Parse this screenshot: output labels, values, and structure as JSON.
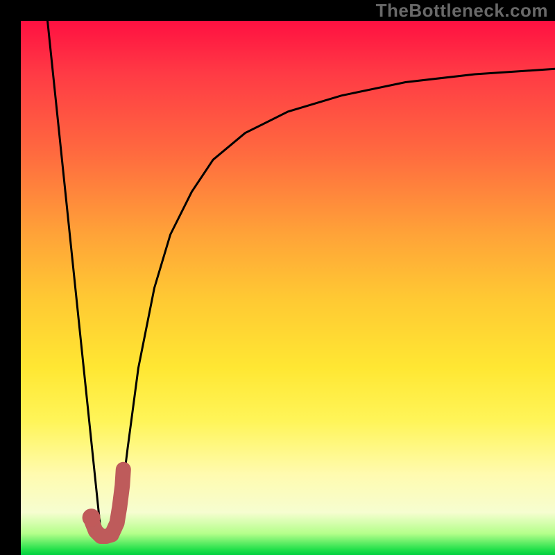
{
  "watermark": "TheBottleneck.com",
  "colors": {
    "frame": "#000000",
    "gradient_top": "#ff1041",
    "gradient_bottom": "#00d040",
    "curve": "#000000",
    "marker": "#c05a5a"
  },
  "chart_data": {
    "type": "line",
    "title": "",
    "xlabel": "",
    "ylabel": "",
    "xlim": [
      0,
      100
    ],
    "ylim": [
      0,
      100
    ],
    "series": [
      {
        "name": "line-left",
        "x": [
          5,
          15
        ],
        "values": [
          100,
          4
        ]
      },
      {
        "name": "curve-right",
        "x": [
          18,
          20,
          22,
          25,
          28,
          32,
          36,
          42,
          50,
          60,
          72,
          85,
          100
        ],
        "values": [
          4,
          20,
          35,
          50,
          60,
          68,
          74,
          79,
          83,
          86,
          88.5,
          90,
          91
        ]
      },
      {
        "name": "marker-J",
        "x": [
          13,
          14,
          15,
          16,
          17,
          18,
          18.5,
          19,
          19.2
        ],
        "values": [
          7,
          4.5,
          3.5,
          3.5,
          3.8,
          6,
          9,
          13,
          16
        ]
      }
    ],
    "marker_dot": {
      "x": 13.2,
      "y": 7
    }
  }
}
